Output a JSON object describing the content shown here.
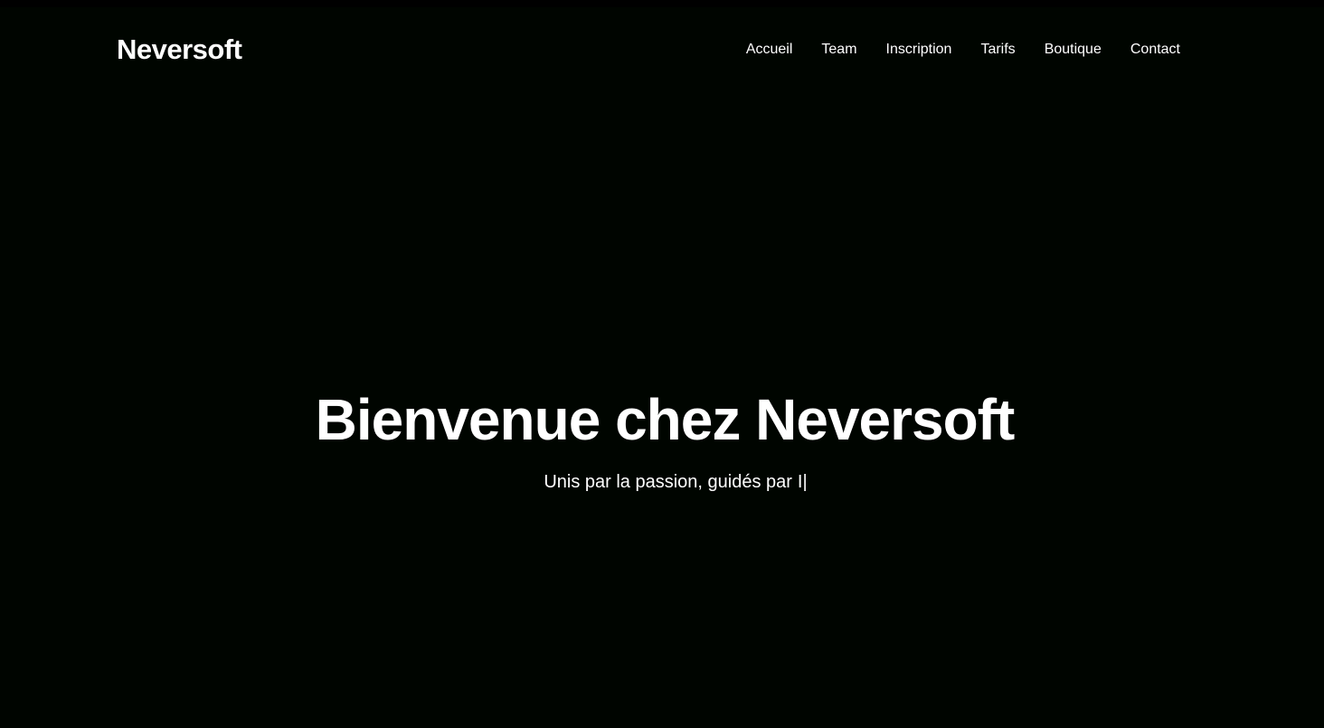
{
  "header": {
    "logo": "Neversoft",
    "nav": [
      {
        "label": "Accueil"
      },
      {
        "label": "Team"
      },
      {
        "label": "Inscription"
      },
      {
        "label": "Tarifs"
      },
      {
        "label": "Boutique"
      },
      {
        "label": "Contact"
      }
    ]
  },
  "hero": {
    "title": "Bienvenue chez Neversoft",
    "subtitle": "Unis par la passion, guidés par",
    "typed_text": "I|"
  },
  "colors": {
    "background": "#000500",
    "text": "#ffffff"
  }
}
